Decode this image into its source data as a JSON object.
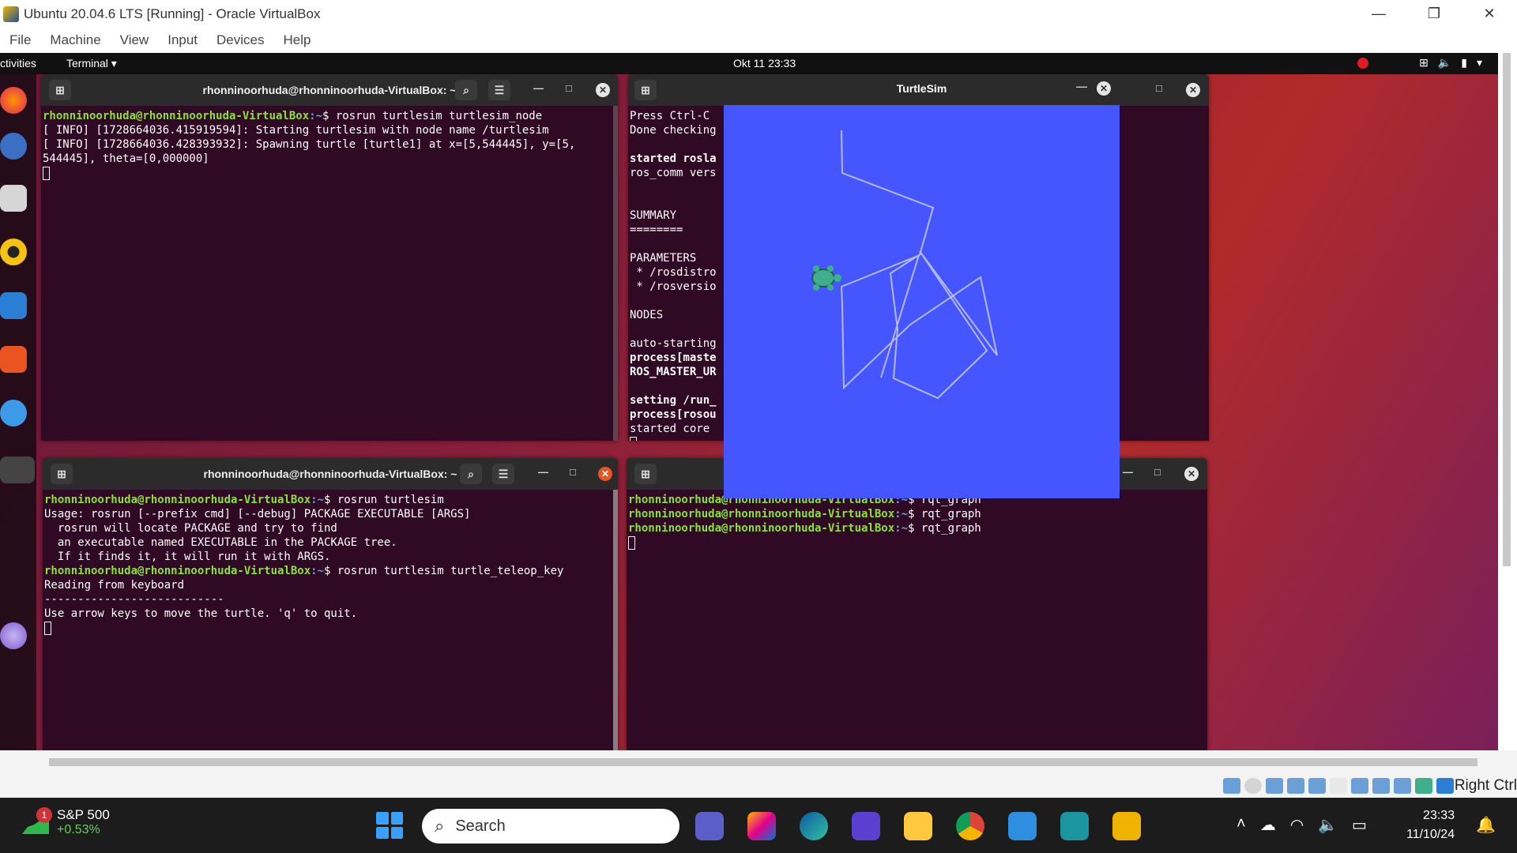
{
  "vbox": {
    "title": "Ubuntu 20.04.6 LTS [Running] - Oracle VirtualBox",
    "controls": {
      "minimize": "—",
      "restore": "❐",
      "close": "✕"
    },
    "menu": [
      "File",
      "Machine",
      "View",
      "Input",
      "Devices",
      "Help"
    ],
    "host_key": "Right Ctrl"
  },
  "ubuntu": {
    "activities": "ctivities",
    "app_menu": "Terminal ▾",
    "clock": "Okt 11  23:33"
  },
  "term1": {
    "title": "rhonninoorhuda@rhonninoorhuda-VirtualBox: ~",
    "lines": [
      {
        "user": "rhonninoorhuda@rhonninoorhuda-VirtualBox",
        "path": ":~",
        "cmd": "$ rosrun turtlesim turtlesim_node"
      },
      {
        "text": "[ INFO] [1728664036.415919594]: Starting turtlesim with node name /turtlesim"
      },
      {
        "text": "[ INFO] [1728664036.428393932]: Spawning turtle [turtle1] at x=[5,544445], y=[5,"
      },
      {
        "text": "544445], theta=[0,000000]"
      }
    ]
  },
  "term2": {
    "lines": [
      {
        "text": "Press Ctrl-C"
      },
      {
        "text": "Done checking"
      },
      {
        "text": ""
      },
      {
        "text": "started rosla",
        "bold": true
      },
      {
        "text": "ros_comm vers"
      },
      {
        "text": ""
      },
      {
        "text": ""
      },
      {
        "text": "SUMMARY"
      },
      {
        "text": "========"
      },
      {
        "text": ""
      },
      {
        "text": "PARAMETERS"
      },
      {
        "text": " * /rosdistro"
      },
      {
        "text": " * /rosversio"
      },
      {
        "text": ""
      },
      {
        "text": "NODES"
      },
      {
        "text": ""
      },
      {
        "text": "auto-starting"
      },
      {
        "text": "process[maste",
        "bold": true
      },
      {
        "text": "ROS_MASTER_UR",
        "bold": true
      },
      {
        "text": ""
      },
      {
        "text": "setting /run_",
        "bold": true
      },
      {
        "text": "process[rosou",
        "bold": true
      },
      {
        "text": "started core "
      }
    ]
  },
  "term3": {
    "title": "rhonninoorhuda@rhonninoorhuda-VirtualBox: ~",
    "lines": [
      {
        "user": "rhonninoorhuda@rhonninoorhuda-VirtualBox",
        "path": ":~",
        "cmd": "$ rosrun turtlesim"
      },
      {
        "text": "Usage: rosrun [--prefix cmd] [--debug] PACKAGE EXECUTABLE [ARGS]"
      },
      {
        "text": "  rosrun will locate PACKAGE and try to find"
      },
      {
        "text": "  an executable named EXECUTABLE in the PACKAGE tree."
      },
      {
        "text": "  If it finds it, it will run it with ARGS."
      },
      {
        "user": "rhonninoorhuda@rhonninoorhuda-VirtualBox",
        "path": ":~",
        "cmd": "$ rosrun turtlesim turtle_teleop_key"
      },
      {
        "text": "Reading from keyboard"
      },
      {
        "text": "---------------------------"
      },
      {
        "text": "Use arrow keys to move the turtle. 'q' to quit."
      }
    ]
  },
  "term4": {
    "lines": [
      {
        "user": "rhonninoorhuda@rhonninoorhuda-VirtualBox",
        "path": ":~",
        "cmd": "$ rqt_graph"
      },
      {
        "user": "rhonninoorhuda@rhonninoorhuda-VirtualBox",
        "path": ":~",
        "cmd": "$ rqt_graph"
      },
      {
        "user": "rhonninoorhuda@rhonninoorhuda-VirtualBox",
        "path": ":~",
        "cmd": "$ rqt_graph"
      }
    ]
  },
  "turtlesim": {
    "title": "TurtleSim",
    "background": "#4556ff",
    "pen_color": "#b3b8ff"
  },
  "taskbar": {
    "widget_name": "S&P 500",
    "widget_change": "+0.53%",
    "widget_badge": "1",
    "search_placeholder": "Search",
    "time": "23:33",
    "date": "11/10/24"
  },
  "icons": {
    "search": "search-icon",
    "hamburger": "menu-icon",
    "new_tab": "new-tab-icon",
    "close": "close-icon",
    "notification": "bell-icon"
  }
}
